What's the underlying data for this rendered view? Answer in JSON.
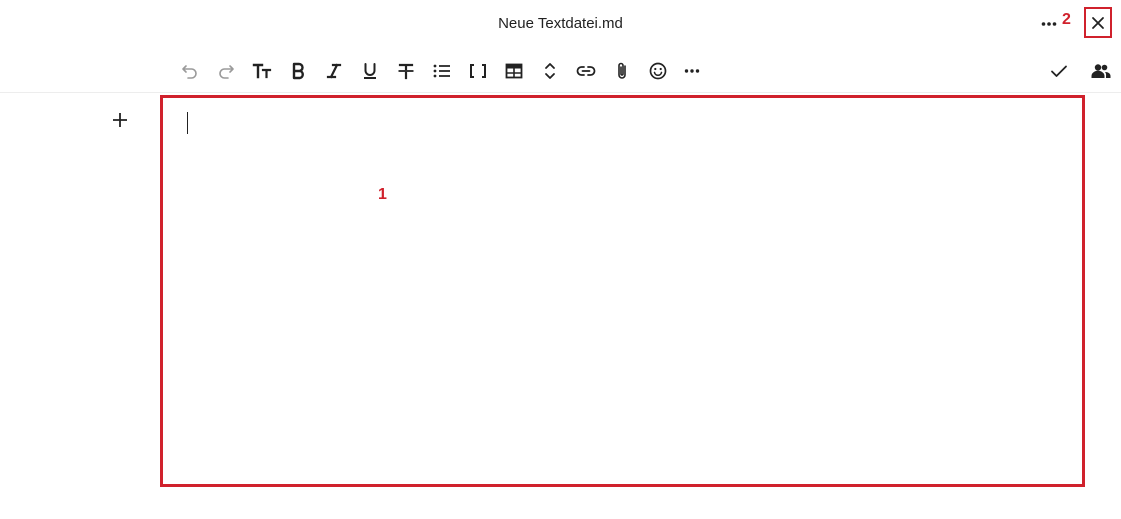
{
  "header": {
    "file_title": "Neue Textdatei.md",
    "more_icon": "dots-horizontal-icon",
    "close_icon": "close-icon"
  },
  "toolbar": {
    "buttons": [
      {
        "icon": "undo-icon"
      },
      {
        "icon": "redo-icon"
      },
      {
        "icon": "text-size-icon"
      },
      {
        "icon": "bold-icon"
      },
      {
        "icon": "italic-icon"
      },
      {
        "icon": "underline-icon"
      },
      {
        "icon": "strikethrough-icon"
      },
      {
        "icon": "bullet-list-icon"
      },
      {
        "icon": "code-brackets-icon"
      },
      {
        "icon": "table-icon"
      },
      {
        "icon": "expand-collapse-icon"
      },
      {
        "icon": "link-icon"
      },
      {
        "icon": "attachment-icon"
      },
      {
        "icon": "emoji-icon"
      },
      {
        "icon": "more-actions-icon"
      }
    ],
    "right": [
      {
        "icon": "checkmark-icon"
      },
      {
        "icon": "people-icon"
      }
    ]
  },
  "editor": {
    "content": "",
    "add_block_icon": "plus-icon"
  },
  "annotations": {
    "editor_label": "1",
    "close_label": "2"
  },
  "colors": {
    "annotation": "#d0212c",
    "icon_dark": "#222222",
    "icon_disabled": "#9a9a9a"
  }
}
